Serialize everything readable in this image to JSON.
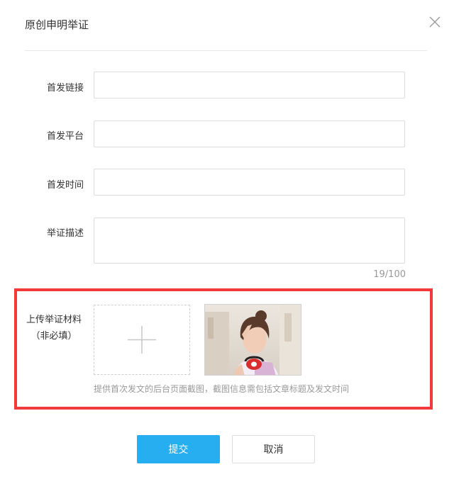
{
  "dialog": {
    "title": "原创申明举证",
    "close_icon": "close-icon"
  },
  "form": {
    "first_link_label": "首发链接",
    "first_link_value": "",
    "first_platform_label": "首发平台",
    "first_platform_value": "",
    "first_time_label": "首发时间",
    "first_time_value": "",
    "description_label": "举证描述",
    "description_value": "",
    "description_counter": "19/100"
  },
  "upload": {
    "label_line1": "上传举证材料",
    "label_line2": "（非必填）",
    "add_icon": "plus-icon",
    "hint": "提供首次发文的后台页面截图，截图信息需包括文章标题及发文时间",
    "highlight_color": "#f23a3a"
  },
  "actions": {
    "submit_label": "提交",
    "cancel_label": "取消",
    "submit_color": "#27aef0"
  }
}
